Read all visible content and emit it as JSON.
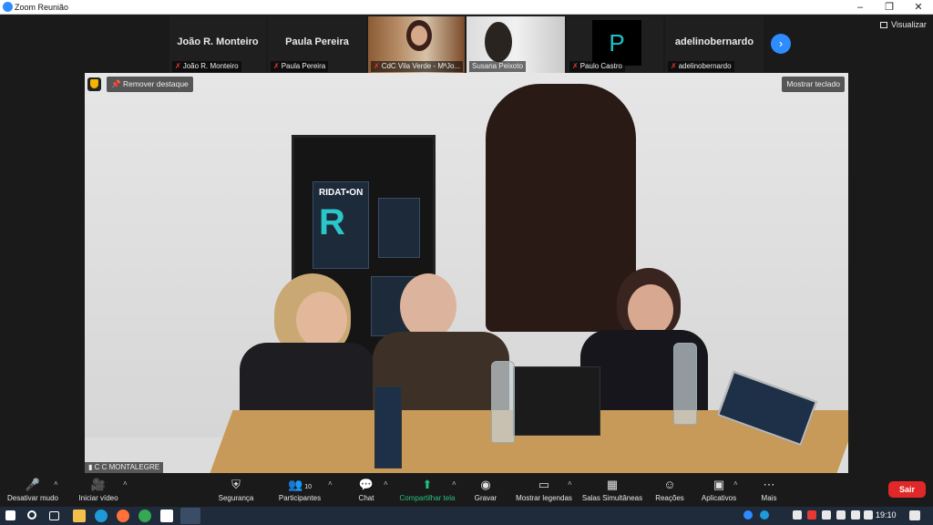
{
  "window": {
    "title": "Zoom Reunião",
    "controls": [
      "minimize-icon",
      "restore-icon",
      "close-icon"
    ]
  },
  "gallery": {
    "tiles": [
      {
        "big_name": "João R. Monteiro",
        "label": "João R. Monteiro",
        "muted": true,
        "kind": "name"
      },
      {
        "big_name": "Paula Pereira",
        "label": "Paula Pereira",
        "muted": true,
        "kind": "name"
      },
      {
        "big_name": "",
        "label": "CdC Vila Verde - MªJo...",
        "muted": true,
        "kind": "video"
      },
      {
        "big_name": "",
        "label": "Susana Peixoto",
        "muted": false,
        "kind": "video"
      },
      {
        "big_name": "P",
        "label": "Paulo Castro",
        "muted": true,
        "kind": "avatar"
      },
      {
        "big_name": "adelinobernardo",
        "label": "adelinobernardo",
        "muted": true,
        "kind": "name"
      }
    ],
    "view_label": "Visualizar"
  },
  "main_video": {
    "remove_spotlight": "Remover destaque",
    "show_keyboard": "Mostrar teclado",
    "speaker": "C C MONTALEGRE",
    "poster_title": "RIDAT•ON",
    "poster_letter": "R"
  },
  "toolbar": {
    "mute": "Desativar mudo",
    "video": "Iniciar vídeo",
    "security": "Segurança",
    "participants": "Participantes",
    "participants_count": "10",
    "chat": "Chat",
    "share": "Compartilhar tela",
    "record": "Gravar",
    "captions": "Mostrar legendas",
    "breakout": "Salas Simultâneas",
    "reactions": "Reações",
    "apps": "Aplicativos",
    "more": "Mais",
    "leave": "Sair"
  },
  "taskbar": {
    "time": "19:10"
  },
  "colors": {
    "accent": "#2d8cff",
    "leave": "#e02828",
    "share": "#26c281",
    "muted": "#e53935"
  }
}
